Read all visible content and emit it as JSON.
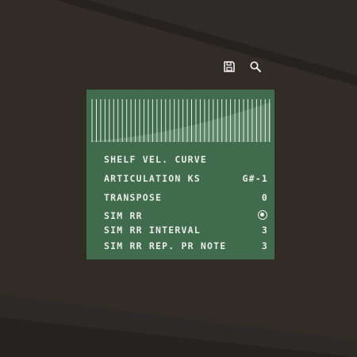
{
  "toolbar": {
    "save_icon": "floppy-disk-icon",
    "search_icon": "magnifier-icon"
  },
  "panel": {
    "title": "SHELF VEL. CURVE",
    "rows": [
      {
        "label": "ARTICULATION KS",
        "value": "G#-1"
      },
      {
        "label": "TRANSPOSE",
        "value": "0"
      },
      {
        "label": "SIM RR",
        "value": ""
      },
      {
        "label": "SIM RR INTERVAL",
        "value": "3"
      },
      {
        "label": "SIM RR REP. PR NOTE",
        "value": "3"
      }
    ],
    "sim_rr_enabled": true
  },
  "colors": {
    "background": "#322c27",
    "panel": "#406b4d",
    "text": "#e8ece8"
  }
}
